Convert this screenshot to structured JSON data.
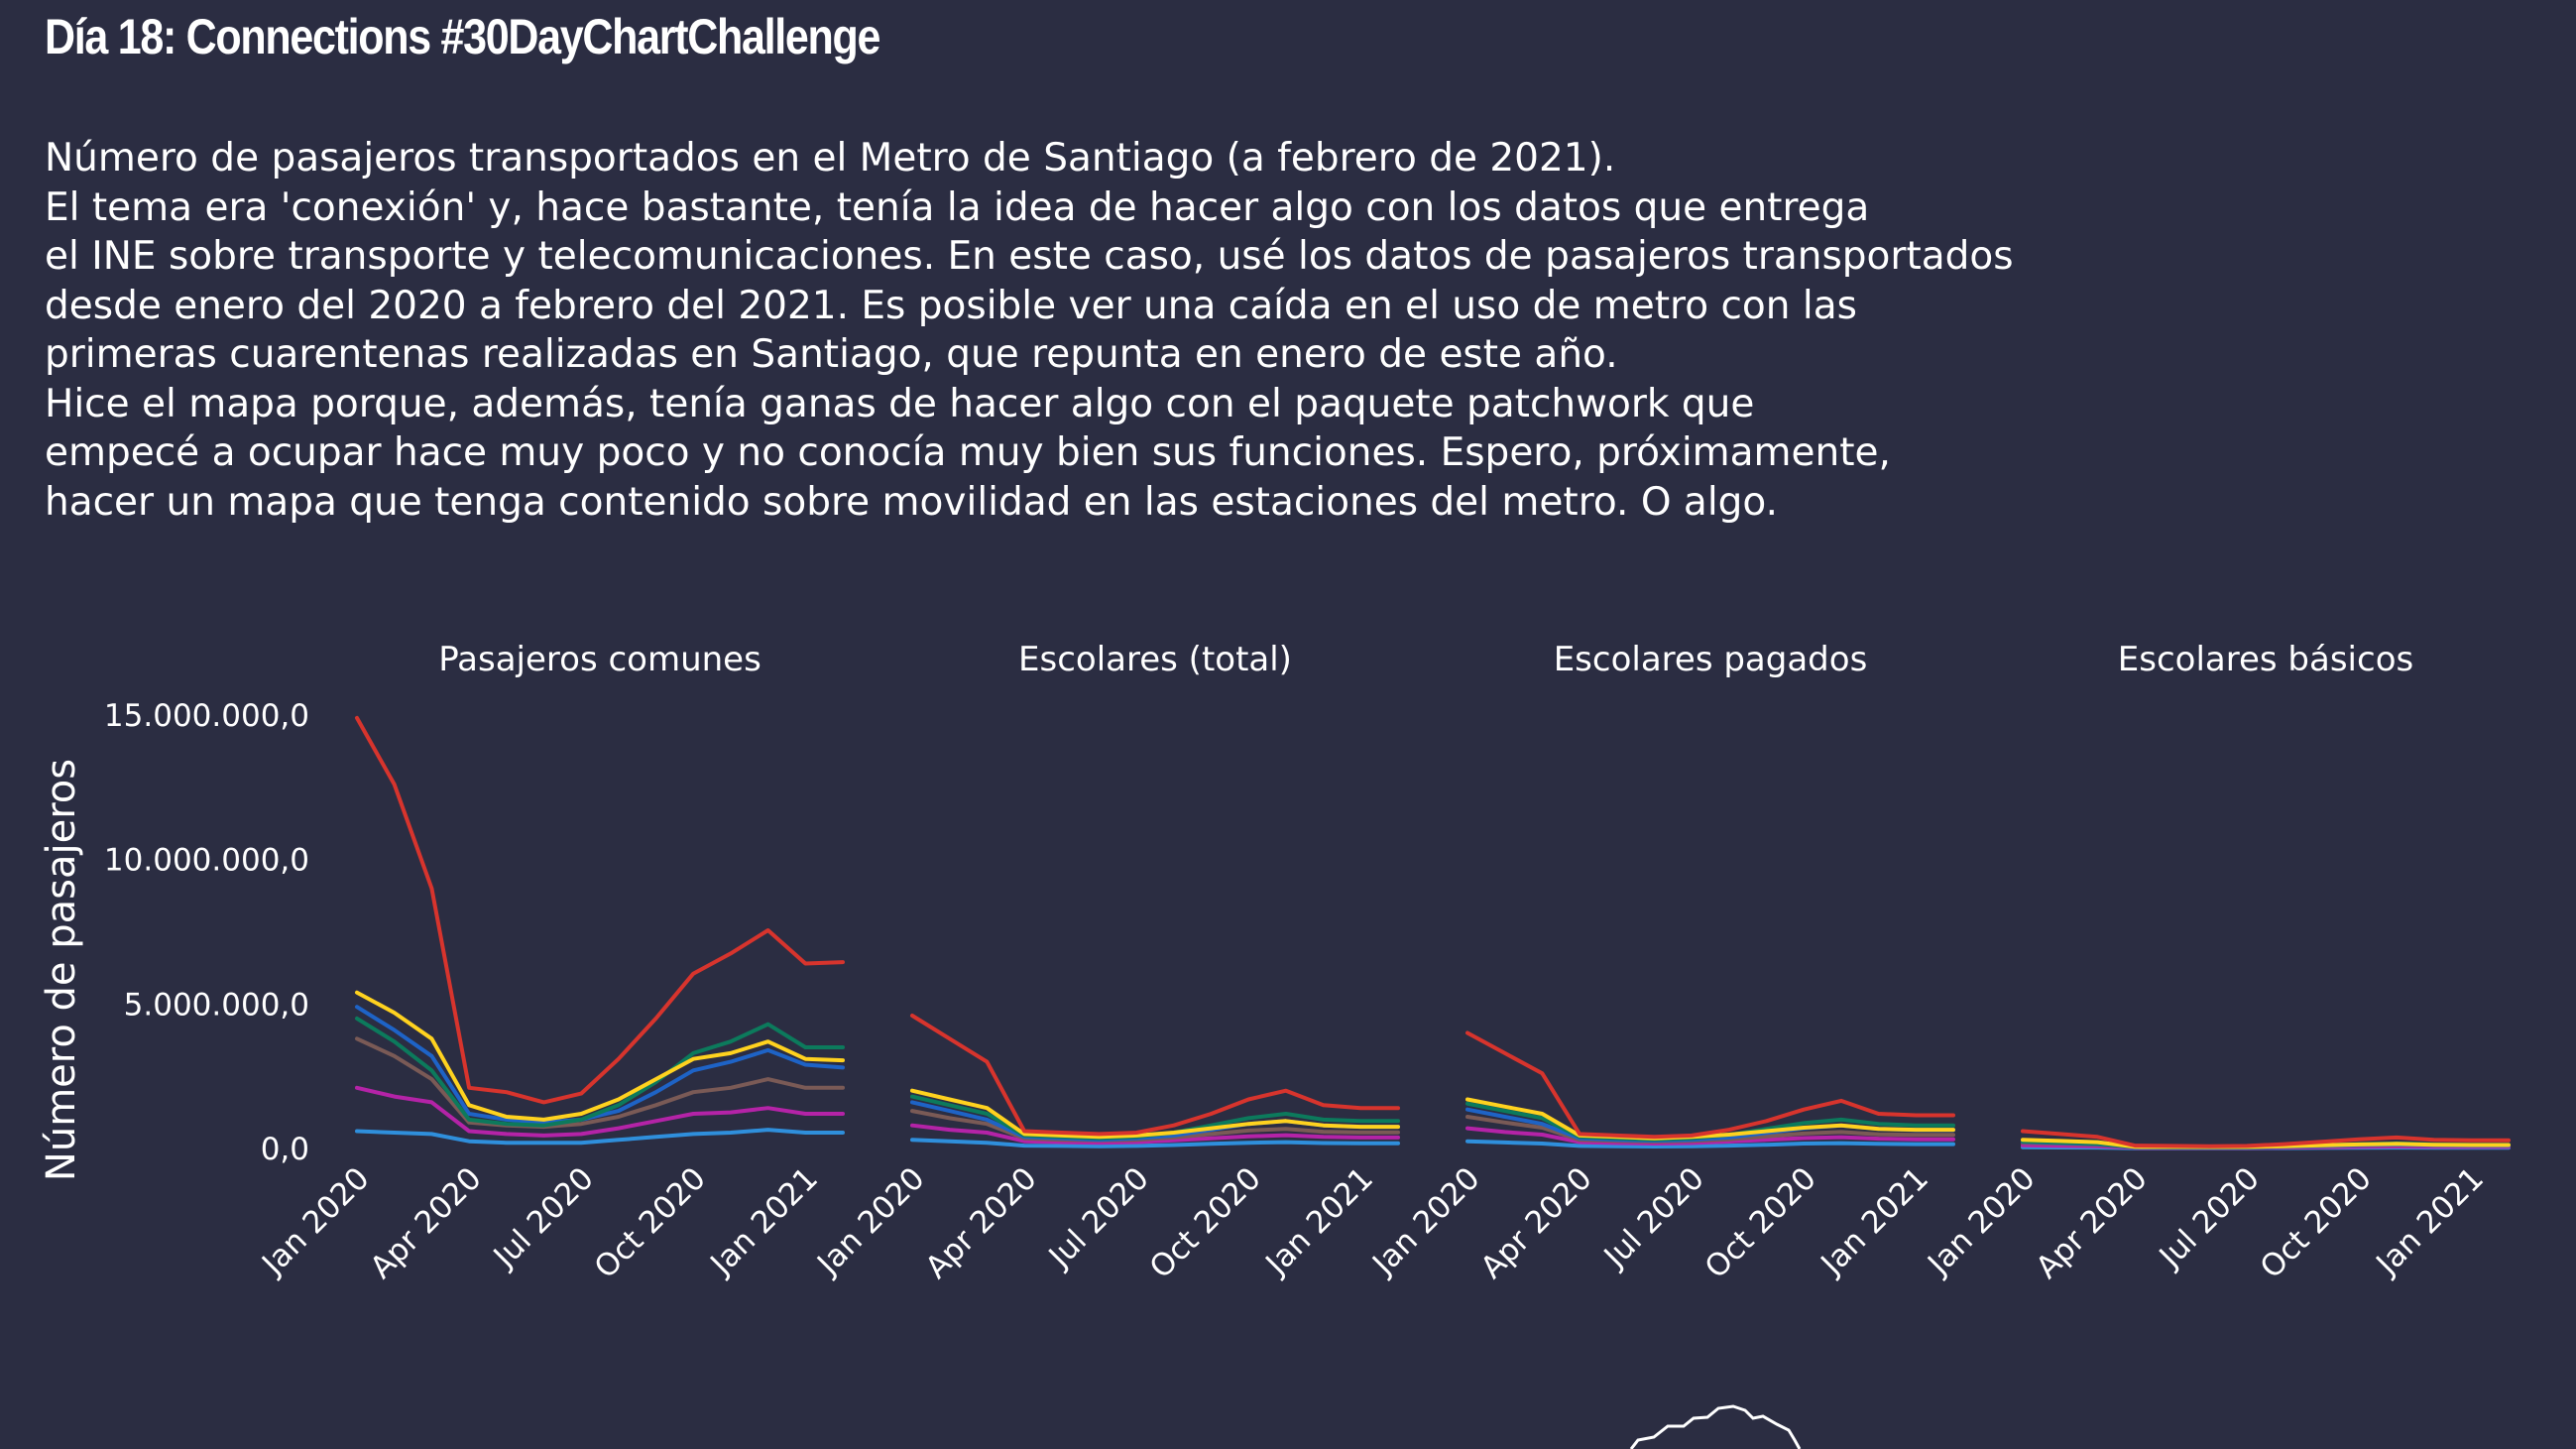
{
  "title": "Día 18: Connections #30DayChartChallenge",
  "subtitle_lines": [
    "Número de pasajeros transportados en el Metro de Santiago (a febrero de 2021).",
    "El tema era 'conexión' y, hace bastante, tenía la idea de hacer algo con los datos que entrega",
    "el INE sobre transporte y telecomunicaciones. En este caso, usé los datos de pasajeros transportados",
    "desde enero del 2020 a febrero del 2021. Es posible ver una caída en el uso de metro con las",
    "primeras cuarentenas realizadas en Santiago, que repunta en enero de este año.",
    "Hice el mapa porque, además, tenía ganas de hacer algo con el paquete patchwork que",
    "empecé a ocupar hace muy poco y no conocía muy bien sus funciones. Espero, próximamente,",
    "hacer un mapa que tenga contenido sobre movilidad en las estaciones del metro. O algo."
  ],
  "colors": {
    "background": "#2b2d42",
    "text": "#ffffff",
    "series": [
      "#d7342d",
      "#ffd21f",
      "#0c7a5c",
      "#1e63c6",
      "#7a5a56",
      "#b423a7",
      "#2f8fdc"
    ]
  },
  "chart_data": {
    "type": "line",
    "facets": [
      "Pasajeros comunes",
      "Escolares (total)",
      "Escolares pagados",
      "Escolares básicos"
    ],
    "ylabel": "Número de pasajeros",
    "xlabel": "",
    "ylim": [
      0,
      15000000
    ],
    "yticks": [
      0,
      5000000,
      10000000,
      15000000
    ],
    "ytick_labels": [
      "0,0",
      "5.000.000,0",
      "10.000.000,0",
      "15.000.000,0"
    ],
    "x": [
      "2020-01",
      "2020-02",
      "2020-03",
      "2020-04",
      "2020-05",
      "2020-06",
      "2020-07",
      "2020-08",
      "2020-09",
      "2020-10",
      "2020-11",
      "2020-12",
      "2021-01",
      "2021-02"
    ],
    "xticks": [
      "2020-01",
      "2020-04",
      "2020-07",
      "2020-10",
      "2021-01"
    ],
    "xtick_labels": [
      "Jan 2020",
      "Apr 2020",
      "Jul 2020",
      "Oct 2020",
      "Jan 2021"
    ],
    "panels": [
      {
        "name": "Pasajeros comunes",
        "series": [
          {
            "values": [
              14900000,
              12600000,
              9000000,
              2100000,
              1950000,
              1600000,
              1900000,
              3100000,
              4500000,
              6050000,
              6750000,
              7550000,
              6400000,
              6450000
            ]
          },
          {
            "values": [
              5400000,
              4700000,
              3800000,
              1500000,
              1100000,
              1000000,
              1200000,
              1700000,
              2400000,
              3100000,
              3300000,
              3700000,
              3100000,
              3050000
            ]
          },
          {
            "values": [
              4500000,
              3700000,
              2700000,
              1000000,
              850000,
              800000,
              1000000,
              1500000,
              2300000,
              3300000,
              3700000,
              4300000,
              3500000,
              3500000
            ]
          },
          {
            "values": [
              4900000,
              4100000,
              3200000,
              1200000,
              1000000,
              900000,
              1000000,
              1300000,
              1950000,
              2700000,
              3000000,
              3400000,
              2900000,
              2800000
            ]
          },
          {
            "values": [
              3800000,
              3200000,
              2400000,
              900000,
              800000,
              750000,
              850000,
              1100000,
              1500000,
              1950000,
              2100000,
              2400000,
              2100000,
              2100000
            ]
          },
          {
            "values": [
              2100000,
              1800000,
              1600000,
              600000,
              500000,
              450000,
              500000,
              700000,
              950000,
              1200000,
              1250000,
              1400000,
              1200000,
              1200000
            ]
          },
          {
            "values": [
              600000,
              550000,
              500000,
              250000,
              200000,
              200000,
              200000,
              300000,
              400000,
              500000,
              550000,
              650000,
              550000,
              550000
            ]
          }
        ]
      },
      {
        "name": "Escolares (total)",
        "series": [
          {
            "values": [
              4600000,
              3800000,
              3000000,
              600000,
              550000,
              500000,
              550000,
              800000,
              1200000,
              1700000,
              2000000,
              1500000,
              1400000,
              1400000
            ]
          },
          {
            "values": [
              2000000,
              1700000,
              1400000,
              500000,
              450000,
              400000,
              450000,
              550000,
              700000,
              850000,
              950000,
              800000,
              750000,
              750000
            ]
          },
          {
            "values": [
              1800000,
              1500000,
              1200000,
              450000,
              400000,
              350000,
              400000,
              550000,
              800000,
              1050000,
              1200000,
              1000000,
              950000,
              950000
            ]
          },
          {
            "values": [
              1600000,
              1300000,
              1000000,
              400000,
              350000,
              300000,
              350000,
              450000,
              650000,
              850000,
              950000,
              800000,
              750000,
              750000
            ]
          },
          {
            "values": [
              1300000,
              1050000,
              850000,
              350000,
              300000,
              280000,
              300000,
              380000,
              500000,
              620000,
              680000,
              580000,
              560000,
              560000
            ]
          },
          {
            "values": [
              800000,
              650000,
              550000,
              250000,
              220000,
              200000,
              220000,
              280000,
              350000,
              420000,
              460000,
              400000,
              380000,
              380000
            ]
          },
          {
            "values": [
              300000,
              250000,
              200000,
              100000,
              90000,
              80000,
              90000,
              120000,
              160000,
              200000,
              220000,
              190000,
              180000,
              180000
            ]
          }
        ]
      },
      {
        "name": "Escolares pagados",
        "series": [
          {
            "values": [
              4000000,
              3300000,
              2600000,
              500000,
              450000,
              400000,
              450000,
              650000,
              950000,
              1350000,
              1650000,
              1200000,
              1150000,
              1150000
            ]
          },
          {
            "values": [
              1700000,
              1450000,
              1200000,
              450000,
              400000,
              350000,
              400000,
              480000,
              600000,
              720000,
              800000,
              680000,
              650000,
              650000
            ]
          },
          {
            "values": [
              1550000,
              1300000,
              1050000,
              400000,
              350000,
              310000,
              350000,
              470000,
              680000,
              880000,
              1000000,
              850000,
              800000,
              800000
            ]
          },
          {
            "values": [
              1350000,
              1100000,
              850000,
              350000,
              300000,
              270000,
              300000,
              380000,
              540000,
              700000,
              800000,
              680000,
              640000,
              640000
            ]
          },
          {
            "values": [
              1100000,
              900000,
              720000,
              300000,
              260000,
              240000,
              260000,
              320000,
              420000,
              520000,
              570000,
              490000,
              470000,
              470000
            ]
          },
          {
            "values": [
              700000,
              570000,
              480000,
              220000,
              190000,
              170000,
              190000,
              240000,
              300000,
              360000,
              390000,
              340000,
              320000,
              320000
            ]
          },
          {
            "values": [
              250000,
              210000,
              170000,
              90000,
              80000,
              70000,
              80000,
              100000,
              130000,
              170000,
              185000,
              160000,
              150000,
              150000
            ]
          }
        ]
      },
      {
        "name": "Escolares básicos",
        "series": [
          {
            "values": [
              600000,
              500000,
              400000,
              100000,
              90000,
              80000,
              90000,
              150000,
              230000,
              320000,
              380000,
              300000,
              280000,
              280000
            ]
          },
          {
            "values": [
              300000,
              260000,
              220000,
              60000,
              55000,
              50000,
              55000,
              80000,
              110000,
              140000,
              160000,
              130000,
              120000,
              120000
            ]
          },
          {
            "values": [
              250000,
              210000,
              170000,
              50000,
              45000,
              40000,
              45000,
              75000,
              110000,
              150000,
              180000,
              140000,
              130000,
              130000
            ]
          },
          {
            "values": [
              230000,
              190000,
              150000,
              45000,
              40000,
              35000,
              40000,
              60000,
              90000,
              120000,
              140000,
              110000,
              100000,
              100000
            ]
          },
          {
            "values": [
              200000,
              170000,
              130000,
              40000,
              35000,
              30000,
              35000,
              55000,
              80000,
              110000,
              130000,
              110000,
              100000,
              100000
            ]
          },
          {
            "values": [
              110000,
              90000,
              75000,
              25000,
              22000,
              20000,
              22000,
              30000,
              45000,
              60000,
              70000,
              60000,
              55000,
              55000
            ]
          },
          {
            "values": [
              40000,
              35000,
              30000,
              12000,
              11000,
              10000,
              11000,
              15000,
              20000,
              26000,
              30000,
              26000,
              24000,
              24000
            ]
          }
        ]
      }
    ]
  }
}
